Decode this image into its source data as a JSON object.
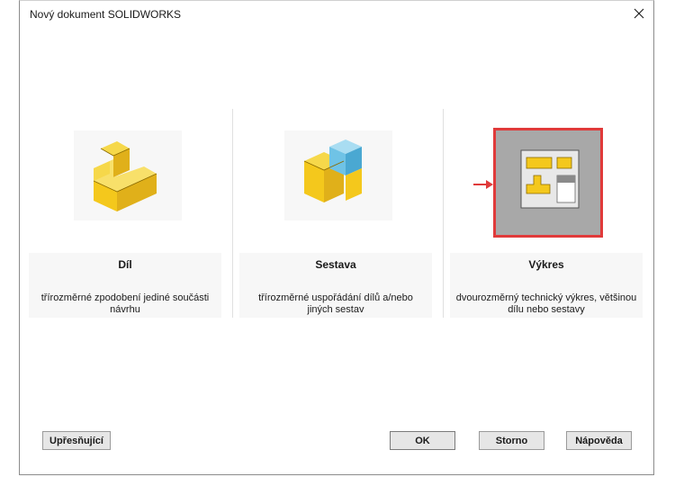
{
  "window": {
    "title": "Nový dokument SOLIDWORKS"
  },
  "templates": [
    {
      "name": "Díl",
      "description": "třírozměrné zpodobení jediné součásti návrhu",
      "icon": "part-icon"
    },
    {
      "name": "Sestava",
      "description": "třírozměrné uspořádání dílů a/nebo jiných sestav",
      "icon": "assembly-icon"
    },
    {
      "name": "Výkres",
      "description": "dvourozměrný technický výkres, většinou dílu nebo sestavy",
      "icon": "drawing-icon",
      "selected": true
    }
  ],
  "buttons": {
    "advanced": "Upřesňující",
    "ok": "OK",
    "cancel": "Storno",
    "help": "Nápověda"
  },
  "colors": {
    "accent_yellow": "#f4c81c",
    "selection_red": "#e03a3a",
    "assembly_blue": "#6fc3e6"
  }
}
